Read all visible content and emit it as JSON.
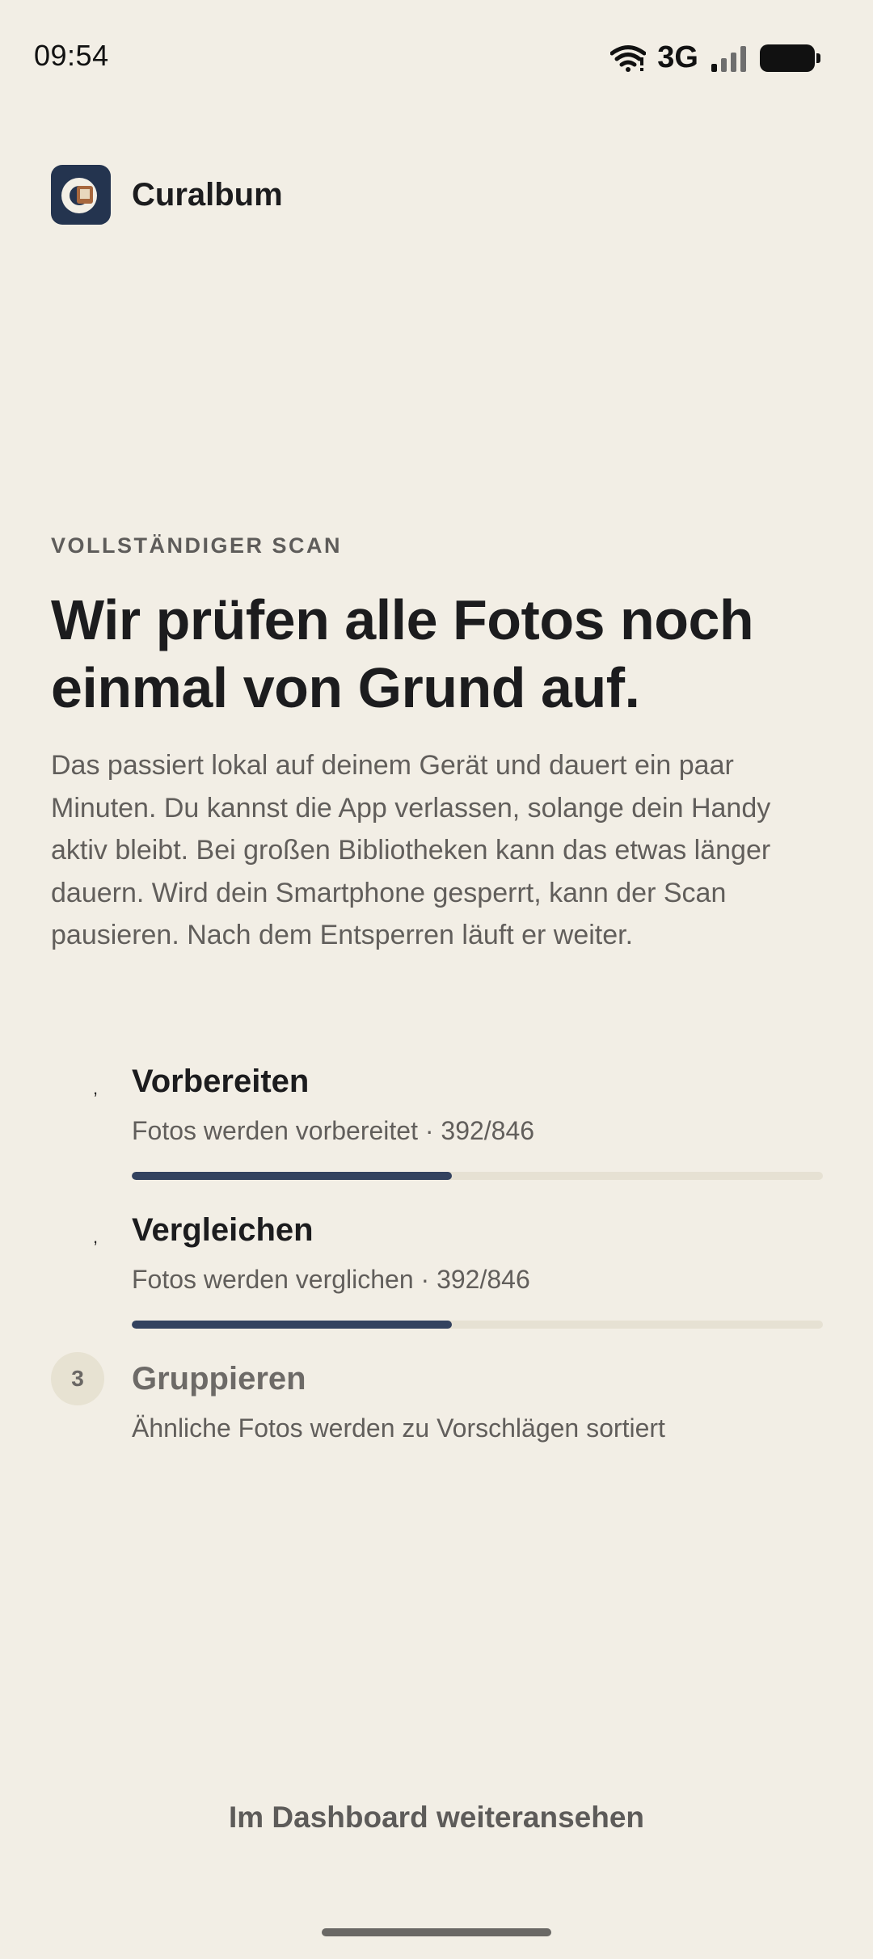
{
  "status_bar": {
    "time": "09:54",
    "network": "3G",
    "icons": [
      "wifi-icon",
      "signal-icon",
      "battery-icon"
    ]
  },
  "app": {
    "name": "Curalbum",
    "logo_icon": "curalbum-logo-icon",
    "accent_color": "#24344f"
  },
  "scan": {
    "eyebrow": "VOLLSTÄNDIGER SCAN",
    "headline": "Wir prüfen alle Fotos noch einmal von Grund auf.",
    "description": "Das passiert lokal auf deinem Gerät und dauert ein paar Minuten. Du kannst die App verlassen, solange dein Handy aktiv bleibt. Bei großen Bibliotheken kann das etwas länger dauern. Wird dein Smartphone gesperrt, kann der Scan pausieren. Nach dem Entsperren läuft er weiter."
  },
  "steps": [
    {
      "title": "Vorbereiten",
      "subtitle": "Fotos werden vorbereitet · 392/846",
      "progress": 0.463,
      "state": "active"
    },
    {
      "title": "Vergleichen",
      "subtitle": "Fotos werden verglichen · 392/846",
      "progress": 0.463,
      "state": "active"
    },
    {
      "number": "3",
      "title": "Gruppieren",
      "subtitle": "Ähnliche Fotos werden zu Vorschlägen sortiert",
      "state": "pending"
    }
  ],
  "footer": {
    "dashboard_link": "Im Dashboard weiteransehen"
  },
  "colors": {
    "background": "#f2eee5",
    "progress_fill": "#33425f",
    "progress_track": "#e6e1d3"
  }
}
